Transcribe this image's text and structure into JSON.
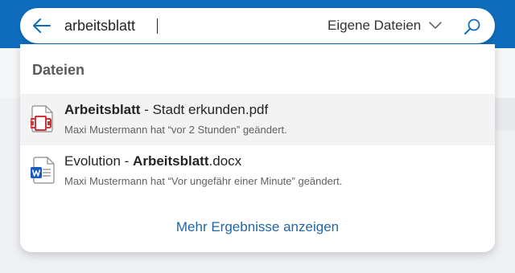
{
  "search": {
    "query": "arbeitsblatt",
    "scope_label": "Eigene Dateien"
  },
  "icons": {
    "back": "arrow-left-icon",
    "scope": "chevron-down-icon",
    "search": "search-icon",
    "pdf": "pdf-file-icon",
    "word": "word-file-icon"
  },
  "colors": {
    "brand": "#0f6cbd",
    "pdf": "#d13438",
    "word": "#185abd",
    "link": "#2266a6"
  },
  "results": {
    "section_title": "Dateien",
    "items": [
      {
        "title_bold": "Arbeitsblatt",
        "title_rest": " - Stadt erkunden.pdf",
        "meta": "Maxi Mustermann hat “vor 2 Stunden” geändert."
      },
      {
        "title_prefix": "Evolution - ",
        "title_bold": "Arbeitsblatt",
        "title_suffix": ".docx",
        "meta": "Maxi Mustermann hat “Vor ungefähr einer Minute” geändert."
      }
    ],
    "more_label": "Mehr Ergebnisse anzeigen"
  }
}
